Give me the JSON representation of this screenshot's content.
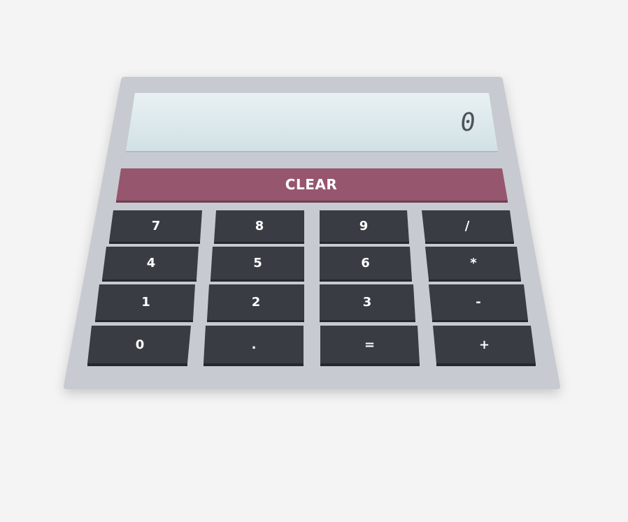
{
  "display": {
    "value": "0"
  },
  "clear_button": {
    "label": "CLEAR"
  },
  "keys": [
    {
      "label": "7",
      "name": "key-7"
    },
    {
      "label": "8",
      "name": "key-8"
    },
    {
      "label": "9",
      "name": "key-9"
    },
    {
      "label": "/",
      "name": "key-divide"
    },
    {
      "label": "4",
      "name": "key-4"
    },
    {
      "label": "5",
      "name": "key-5"
    },
    {
      "label": "6",
      "name": "key-6"
    },
    {
      "label": "*",
      "name": "key-multiply"
    },
    {
      "label": "1",
      "name": "key-1"
    },
    {
      "label": "2",
      "name": "key-2"
    },
    {
      "label": "3",
      "name": "key-3"
    },
    {
      "label": "-",
      "name": "key-subtract"
    },
    {
      "label": "0",
      "name": "key-0"
    },
    {
      "label": ".",
      "name": "key-decimal"
    },
    {
      "label": "=",
      "name": "key-equals"
    },
    {
      "label": "+",
      "name": "key-add"
    }
  ],
  "colors": {
    "body": "#c7cad0",
    "screen": "#dbe7ea",
    "clear": "#96566e",
    "key": "#393d43",
    "background": "#f4f4f4"
  }
}
